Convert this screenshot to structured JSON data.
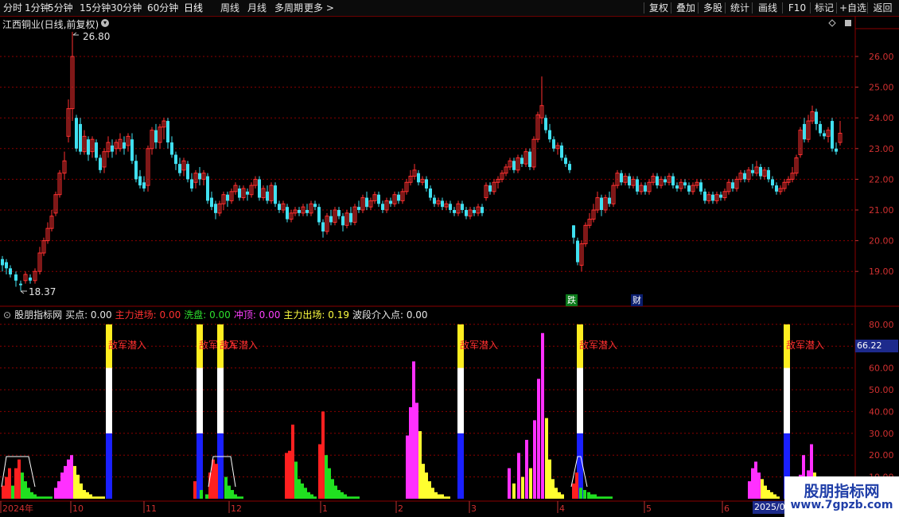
{
  "toolbar": {
    "periods": [
      "分时",
      "1分钟",
      "5分钟",
      "15分钟",
      "30分钟",
      "60分钟",
      "日线",
      "周线",
      "月线",
      "多周期",
      "更多 >"
    ],
    "active_period": "日线",
    "actions": [
      "复权",
      "叠加",
      "多股",
      "统计",
      "画线",
      "F10",
      "标记",
      "+自选",
      "返回"
    ]
  },
  "main_chart": {
    "title": "江西铜业(日线,前复权)",
    "high_label": "26.80",
    "low_label": "18.37",
    "price_axis": [
      "26.00",
      "25.00",
      "24.00",
      "23.00",
      "22.00",
      "21.00",
      "20.00",
      "19.00"
    ],
    "event_tags": [
      "跌",
      "财"
    ]
  },
  "indicator": {
    "name": "股朋指标网",
    "fields": [
      {
        "label": "买点:",
        "value": "0.00",
        "color": "#e6e6e6"
      },
      {
        "label": "主力进场:",
        "value": "0.00",
        "color": "#ff3030"
      },
      {
        "label": "洗盘:",
        "value": "0.00",
        "color": "#2de02d"
      },
      {
        "label": "冲顶:",
        "value": "0.00",
        "color": "#ff40ff"
      },
      {
        "label": "主力出场:",
        "value": "0.19",
        "color": "#ffff40"
      },
      {
        "label": "波段介入点:",
        "value": "0.00",
        "color": "#e6e6e6"
      }
    ],
    "axis": [
      "80.00",
      "70.00",
      "60.00",
      "50.00",
      "40.00",
      "30.00",
      "20.00",
      "10.00"
    ],
    "current_value": "66.22",
    "signal_label": "敌军潜入"
  },
  "time_axis": {
    "labels": [
      "2024年",
      "10",
      "11",
      "12",
      "1",
      "2",
      "3",
      "4",
      "5",
      "6"
    ],
    "highlight": "2025/0"
  },
  "watermark": {
    "line1": "股朋指标网",
    "line2": "www.7gpzb.com"
  },
  "colors": {
    "up": "#ff3030",
    "down": "#40e0f0",
    "grid": "#8b0000",
    "axis_text": "#d03030"
  },
  "chart_data": {
    "type": "candlestick+bar",
    "price_range": [
      18.37,
      26.8
    ],
    "indicator_range": [
      0,
      80
    ]
  }
}
